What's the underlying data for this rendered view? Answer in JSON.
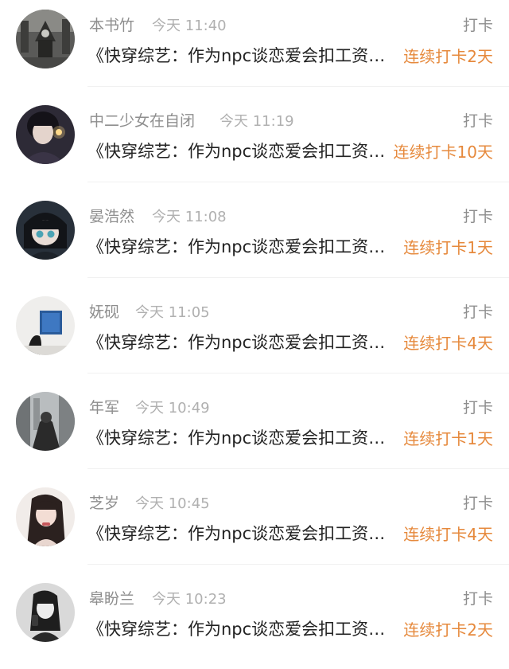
{
  "entries": [
    {
      "name": "本书竹",
      "time": "今天 11:40",
      "action": "打卡",
      "text": "《快穿综艺：作为npc谈恋爱会扣工资吗》",
      "streak": "连续打卡2天",
      "avatar": "avatar-1-icon"
    },
    {
      "name": "中二少女在自闭",
      "time": "今天 11:19",
      "action": "打卡",
      "text": "《快穿综艺：作为npc谈恋爱会扣工资吗》",
      "streak": "连续打卡10天",
      "avatar": "avatar-2-icon"
    },
    {
      "name": "晏浩然",
      "time": "今天 11:08",
      "action": "打卡",
      "text": "《快穿综艺：作为npc谈恋爱会扣工资吗》",
      "streak": "连续打卡1天",
      "avatar": "avatar-3-icon"
    },
    {
      "name": "妩砚",
      "time": "今天 11:05",
      "action": "打卡",
      "text": "《快穿综艺：作为npc谈恋爱会扣工资吗》",
      "streak": "连续打卡4天",
      "avatar": "avatar-4-icon"
    },
    {
      "name": "年军",
      "time": "今天 10:49",
      "action": "打卡",
      "text": "《快穿综艺：作为npc谈恋爱会扣工资吗》",
      "streak": "连续打卡1天",
      "avatar": "avatar-5-icon"
    },
    {
      "name": "芝岁",
      "time": "今天 10:45",
      "action": "打卡",
      "text": "《快穿综艺：作为npc谈恋爱会扣工资吗》",
      "streak": "连续打卡4天",
      "avatar": "avatar-6-icon"
    },
    {
      "name": "皋盼兰",
      "time": "今天 10:23",
      "action": "打卡",
      "text": "《快穿综艺：作为npc谈恋爱会扣工资吗》",
      "streak": "连续打卡2天",
      "avatar": "avatar-7-icon"
    }
  ],
  "colors": {
    "streak": "#e6893c",
    "name": "#8e8e8e",
    "time": "#b0b0b0",
    "text": "#222222"
  }
}
